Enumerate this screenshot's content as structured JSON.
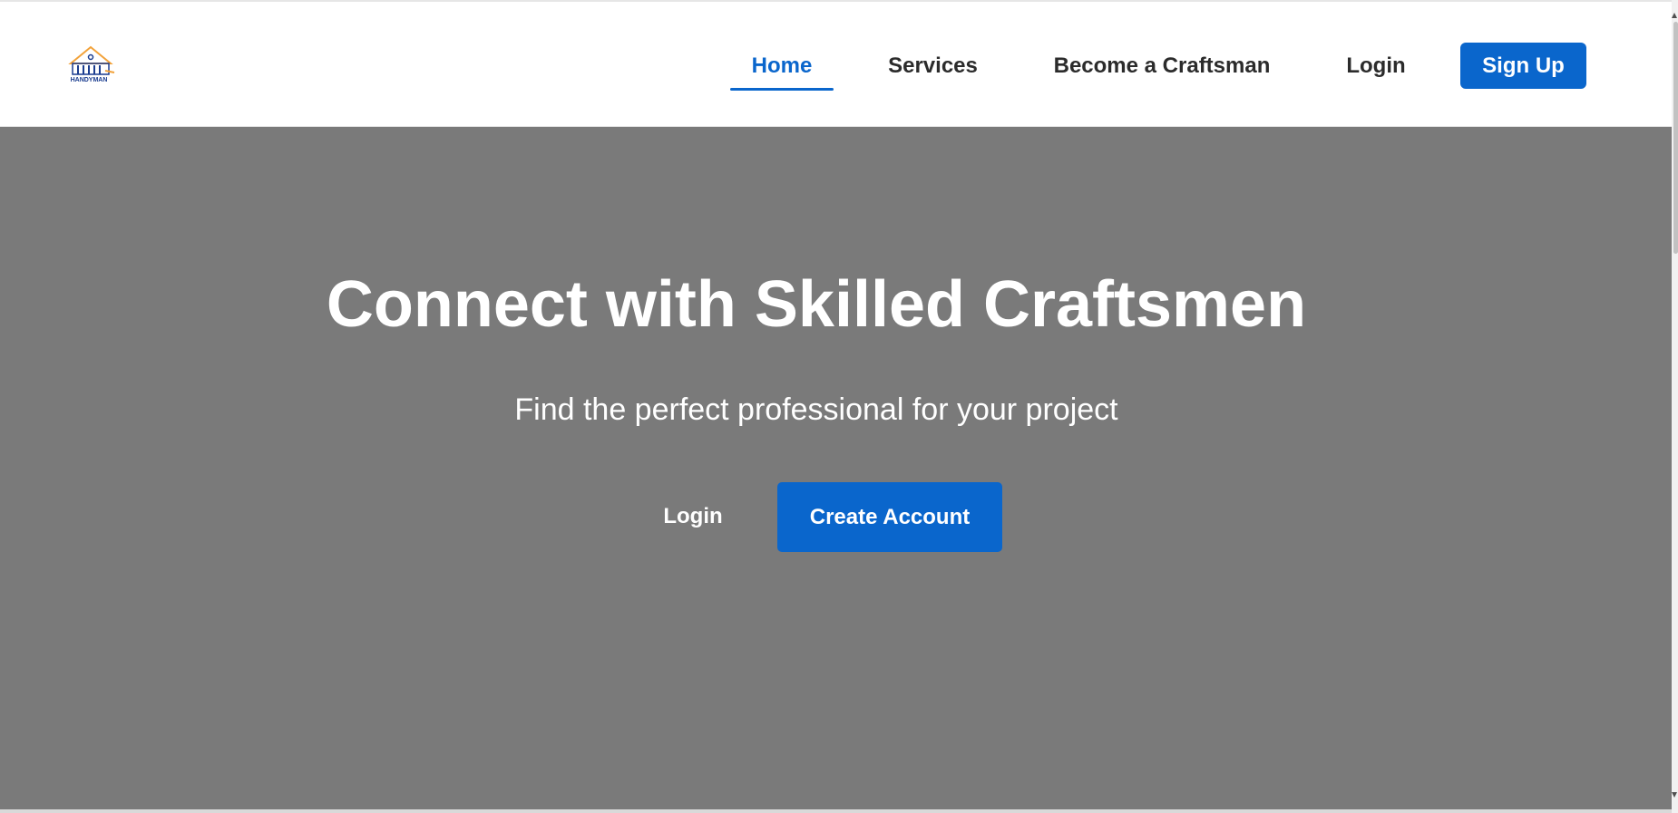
{
  "logo": {
    "text": "HANDYMAN",
    "primary_color": "#1a3c8f",
    "accent_color": "#f2a23a"
  },
  "nav": {
    "items": [
      {
        "label": "Home",
        "active": true
      },
      {
        "label": "Services",
        "active": false
      },
      {
        "label": "Become a Craftsman",
        "active": false
      },
      {
        "label": "Login",
        "active": false
      }
    ],
    "signup_label": "Sign Up"
  },
  "hero": {
    "title": "Connect with Skilled Craftsmen",
    "subtitle": "Find the perfect professional for your project",
    "login_label": "Login",
    "create_label": "Create Account"
  },
  "colors": {
    "accent": "#0a66cc",
    "hero_background": "#7a7a7a",
    "nav_text": "#2b2b2b"
  }
}
